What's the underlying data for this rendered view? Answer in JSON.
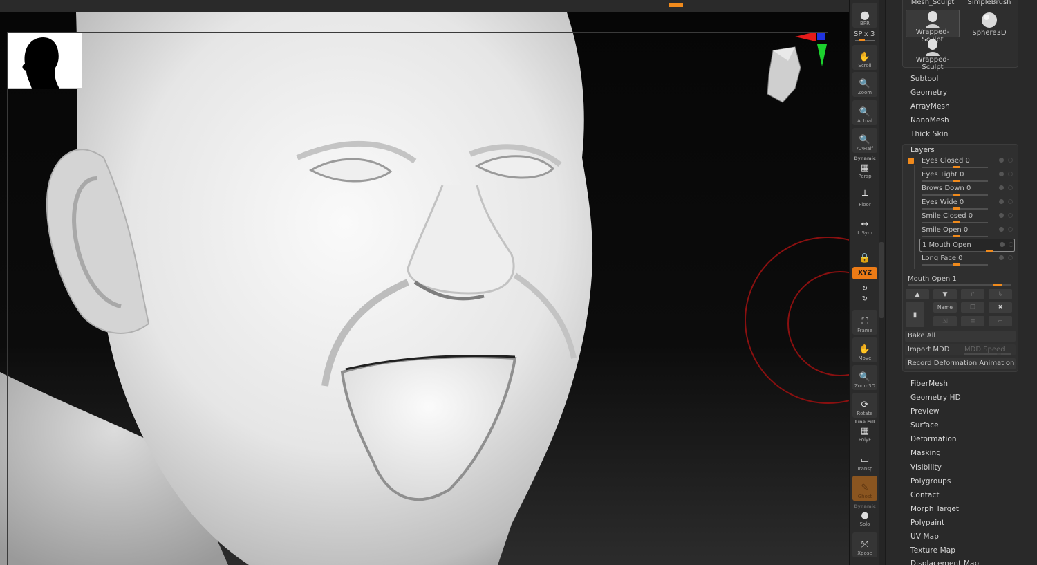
{
  "topbar": {
    "accent": "#f08a1c"
  },
  "viewport": {
    "model": "head-sculpt",
    "silhouette_icon": "head-silhouette-icon",
    "orient_icon": "mini-head-icon"
  },
  "toolbar": {
    "spix_label": "SPix 3",
    "buttons": [
      {
        "label": "BPR",
        "icon": "sphere-icon"
      },
      {
        "label": "Scroll",
        "icon": "hand-scroll-icon"
      },
      {
        "label": "Zoom",
        "icon": "zoom-icon"
      },
      {
        "label": "Actual",
        "icon": "actual-icon"
      },
      {
        "label": "AAHalf",
        "icon": "aahalf-icon"
      },
      {
        "label": "Persp",
        "top": "Dynamic",
        "icon": "persp-icon"
      },
      {
        "label": "Floor",
        "icon": "floor-icon"
      },
      {
        "label": "L.Sym",
        "icon": "lsym-icon"
      },
      {
        "label": "",
        "icon": "lock-icon"
      },
      {
        "label": "XYZ",
        "icon": "xyz-icon"
      },
      {
        "label": "Frame",
        "icon": "frame-icon"
      },
      {
        "label": "Move",
        "icon": "move-icon"
      },
      {
        "label": "Zoom3D",
        "icon": "zoom3d-icon"
      },
      {
        "label": "Rotate",
        "icon": "rotate-icon"
      },
      {
        "label": "PolyF",
        "top": "Line Fill",
        "icon": "polyf-icon"
      },
      {
        "label": "Transp",
        "icon": "transp-icon"
      },
      {
        "label": "Ghost",
        "icon": "ghost-icon"
      },
      {
        "label": "Solo",
        "top": "Dynamic",
        "icon": "solo-icon"
      },
      {
        "label": "Xpose",
        "icon": "xpose-icon"
      }
    ]
  },
  "tools": [
    {
      "label": "Mesh_Sculpt"
    },
    {
      "label": "SimpleBrush"
    },
    {
      "label": "Wrapped-Sculpt"
    },
    {
      "label": "Sphere3D"
    },
    {
      "label": "Wrapped-Sculpt"
    }
  ],
  "menu_top": [
    "Subtool",
    "Geometry",
    "ArrayMesh",
    "NanoMesh",
    "Thick Skin"
  ],
  "layers": {
    "title": "Layers",
    "items": [
      {
        "name": "Eyes Closed 0",
        "value": 0
      },
      {
        "name": "Eyes Tight 0",
        "value": 0
      },
      {
        "name": "Brows Down 0",
        "value": 0
      },
      {
        "name": "Eyes Wide 0",
        "value": 0
      },
      {
        "name": "Smile Closed 0",
        "value": 0
      },
      {
        "name": "Smile Open 0",
        "value": 0
      },
      {
        "name": "1 Mouth Open",
        "value": 1
      },
      {
        "name": "Long Face 0",
        "value": 0
      }
    ],
    "intensity_label": "Mouth Open 1",
    "intensity_value": 1,
    "name_button": "Name",
    "bake_all": "Bake All",
    "import_mdd": "Import MDD",
    "mdd_speed": "MDD Speed",
    "record": "Record Deformation Animation"
  },
  "menu_bottom": [
    "FiberMesh",
    "Geometry HD",
    "Preview",
    "Surface",
    "Deformation",
    "Masking",
    "Visibility",
    "Polygroups",
    "Contact",
    "Morph Target",
    "Polypaint",
    "UV Map",
    "Texture Map",
    "Displacement Map"
  ]
}
